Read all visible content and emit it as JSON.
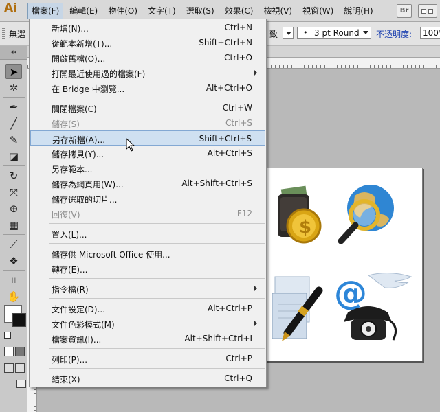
{
  "app": {
    "logo": "Ai"
  },
  "menubar": {
    "items": [
      "檔案(F)",
      "編輯(E)",
      "物件(O)",
      "文字(T)",
      "選取(S)",
      "效果(C)",
      "檢視(V)",
      "視窗(W)",
      "說明(H)"
    ],
    "active_index": 0,
    "bridge_button": "Br"
  },
  "controlbar": {
    "selection_label": "無選",
    "uniform_suffix": "致",
    "stroke_profile_dot": "•",
    "stroke_profile": "3 pt Round",
    "opacity_label": "不透明度:",
    "opacity_value": "100%"
  },
  "toolbox": {
    "tools": [
      {
        "name": "selection-tool-icon",
        "glyph": "➤"
      },
      {
        "name": "magic-wand-tool-icon",
        "glyph": "✲"
      },
      {
        "name": "pen-tool-icon",
        "glyph": "✒"
      },
      {
        "name": "line-tool-icon",
        "glyph": "╱"
      },
      {
        "name": "paintbrush-tool-icon",
        "glyph": "✎"
      },
      {
        "name": "blob-brush-tool-icon",
        "glyph": "◪"
      },
      {
        "name": "rotate-tool-icon",
        "glyph": "↻"
      },
      {
        "name": "width-tool-icon",
        "glyph": "⤧"
      },
      {
        "name": "shape-builder-tool-icon",
        "glyph": "⊕"
      },
      {
        "name": "perspective-grid-tool-icon",
        "glyph": "▦"
      },
      {
        "name": "eyedropper-tool-icon",
        "glyph": "⟋"
      },
      {
        "name": "symbol-sprayer-tool-icon",
        "glyph": "❖"
      },
      {
        "name": "artboard-tool-icon",
        "glyph": "⌗"
      },
      {
        "name": "hand-tool-icon",
        "glyph": "✋"
      }
    ]
  },
  "file_menu": {
    "items": [
      {
        "label": "新增(N)...",
        "shortcut": "Ctrl+N"
      },
      {
        "label": "從範本新增(T)...",
        "shortcut": "Shift+Ctrl+N"
      },
      {
        "label": "開啟舊檔(O)...",
        "shortcut": "Ctrl+O"
      },
      {
        "label": "打開最近使用過的檔案(F)",
        "shortcut": "",
        "submenu": true
      },
      {
        "label": "在 Bridge 中瀏覽...",
        "shortcut": "Alt+Ctrl+O"
      },
      {
        "label": "關閉檔案(C)",
        "shortcut": "Ctrl+W"
      },
      {
        "label": "儲存(S)",
        "shortcut": "Ctrl+S",
        "disabled": true
      },
      {
        "label": "另存新檔(A)...",
        "shortcut": "Shift+Ctrl+S",
        "highlighted": true
      },
      {
        "label": "儲存拷貝(Y)...",
        "shortcut": "Alt+Ctrl+S"
      },
      {
        "label": "另存範本...",
        "shortcut": ""
      },
      {
        "label": "儲存為網頁用(W)...",
        "shortcut": "Alt+Shift+Ctrl+S"
      },
      {
        "label": "儲存選取的切片...",
        "shortcut": ""
      },
      {
        "label": "回復(V)",
        "shortcut": "F12",
        "disabled": true
      },
      {
        "label": "置入(L)...",
        "shortcut": ""
      },
      {
        "label": "儲存供 Microsoft Office 使用...",
        "shortcut": ""
      },
      {
        "label": "轉存(E)...",
        "shortcut": ""
      },
      {
        "label": "指令檔(R)",
        "shortcut": "",
        "submenu": true
      },
      {
        "label": "文件設定(D)...",
        "shortcut": "Alt+Ctrl+P"
      },
      {
        "label": "文件色彩模式(M)",
        "shortcut": "",
        "submenu": true
      },
      {
        "label": "檔案資訊(I)...",
        "shortcut": "Alt+Shift+Ctrl+I"
      },
      {
        "label": "列印(P)...",
        "shortcut": "Ctrl+P"
      },
      {
        "label": "結束(X)",
        "shortcut": "Ctrl+Q"
      }
    ]
  },
  "artboard": {
    "icons": [
      "wallet-coin-icon",
      "globe-magnifier-icon",
      "document-pen-icon",
      "email-telephone-icon"
    ]
  }
}
